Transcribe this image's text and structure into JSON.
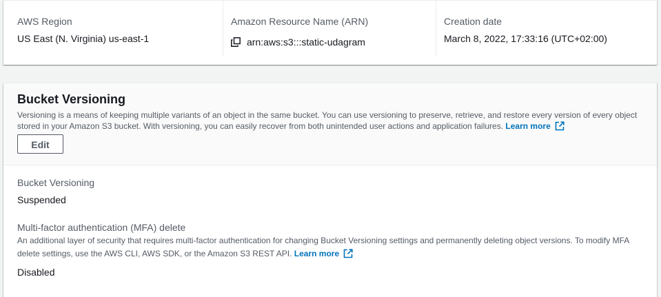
{
  "properties": {
    "region": {
      "label": "AWS Region",
      "value": "US East (N. Virginia) us-east-1"
    },
    "arn": {
      "label": "Amazon Resource Name (ARN)",
      "value": "arn:aws:s3:::static-udagram"
    },
    "creation_date": {
      "label": "Creation date",
      "value": "March 8, 2022, 17:33:16 (UTC+02:00)"
    }
  },
  "bucket_versioning": {
    "title": "Bucket Versioning",
    "description": "Versioning is a means of keeping multiple variants of an object in the same bucket. You can use versioning to preserve, retrieve, and restore every version of every object stored in your Amazon S3 bucket. With versioning, you can easily recover from both unintended user actions and application failures.",
    "learn_more": "Learn more",
    "edit_label": "Edit",
    "versioning_status": {
      "label": "Bucket Versioning",
      "value": "Suspended"
    },
    "mfa_delete": {
      "label": "Multi-factor authentication (MFA) delete",
      "description": "An additional layer of security that requires multi-factor authentication for changing Bucket Versioning settings and permanently deleting object versions. To modify MFA delete settings, use the AWS CLI, AWS SDK, or the Amazon S3 REST API.",
      "learn_more": "Learn more",
      "value": "Disabled"
    }
  },
  "colors": {
    "link": "#0073bb",
    "label": "#545b64",
    "text": "#16191f",
    "page_bg": "#f2f3f3",
    "header_bg": "#fafafa"
  },
  "icons": {
    "copy": "copy-icon",
    "external": "external-link-icon"
  }
}
